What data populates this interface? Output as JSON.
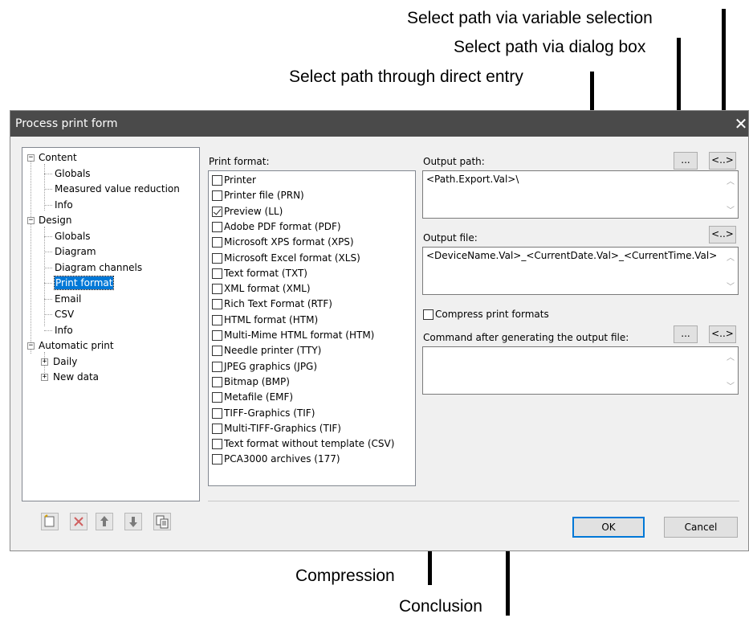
{
  "annotations": {
    "variable_selection": "Select path via variable selection",
    "dialog_box": "Select path via dialog box",
    "direct_entry": "Select path through direct entry",
    "compression": "Compression",
    "conclusion": "Conclusion"
  },
  "dialog": {
    "title": "Process print form",
    "close_glyph": "✕"
  },
  "tree": {
    "items": [
      {
        "label": "Content",
        "expander": "−"
      },
      {
        "label": "Globals"
      },
      {
        "label": "Measured value reduction"
      },
      {
        "label": "Info"
      },
      {
        "label": "Design",
        "expander": "−"
      },
      {
        "label": "Globals"
      },
      {
        "label": "Diagram"
      },
      {
        "label": "Diagram channels"
      },
      {
        "label": "Print format",
        "selected": true
      },
      {
        "label": "Email"
      },
      {
        "label": "CSV"
      },
      {
        "label": "Info"
      },
      {
        "label": "Automatic print",
        "expander": "−"
      },
      {
        "label": "Daily",
        "expander": "+"
      },
      {
        "label": "New data",
        "expander": "+"
      }
    ]
  },
  "toolbar": {
    "icons": [
      "new-entry-icon",
      "delete-icon",
      "move-up-icon",
      "move-down-icon",
      "copy-icon"
    ]
  },
  "print_format": {
    "label": "Print format:",
    "options": [
      {
        "label": "Printer",
        "checked": false
      },
      {
        "label": "Printer file (PRN)",
        "checked": false
      },
      {
        "label": "Preview (LL)",
        "checked": true
      },
      {
        "label": "Adobe PDF format (PDF)",
        "checked": false
      },
      {
        "label": "Microsoft XPS format (XPS)",
        "checked": false
      },
      {
        "label": "Microsoft Excel format (XLS)",
        "checked": false
      },
      {
        "label": "Text format (TXT)",
        "checked": false
      },
      {
        "label": "XML format (XML)",
        "checked": false
      },
      {
        "label": "Rich Text Format (RTF)",
        "checked": false
      },
      {
        "label": "HTML format (HTM)",
        "checked": false
      },
      {
        "label": "Multi-Mime HTML format (HTM)",
        "checked": false
      },
      {
        "label": "Needle printer (TTY)",
        "checked": false
      },
      {
        "label": "JPEG graphics (JPG)",
        "checked": false
      },
      {
        "label": "Bitmap (BMP)",
        "checked": false
      },
      {
        "label": "Metafile (EMF)",
        "checked": false
      },
      {
        "label": "TIFF-Graphics (TIF)",
        "checked": false
      },
      {
        "label": "Multi-TIFF-Graphics (TIF)",
        "checked": false
      },
      {
        "label": "Text format without template (CSV)",
        "checked": false
      },
      {
        "label": "PCA3000 archives (177)",
        "checked": false
      }
    ]
  },
  "output_path": {
    "label": "Output path:",
    "value": "<Path.Export.Val>\\",
    "dialog_btn": "...",
    "variable_btn": "<..>"
  },
  "output_file": {
    "label": "Output file:",
    "value": "<DeviceName.Val>_<CurrentDate.Val>_<CurrentTime.Val>",
    "variable_btn": "<..>"
  },
  "compress": {
    "label": "Compress print formats",
    "checked": false
  },
  "command": {
    "label": "Command after generating the output file:",
    "value": "",
    "dialog_btn": "...",
    "variable_btn": "<..>"
  },
  "buttons": {
    "ok": "OK",
    "cancel": "Cancel"
  }
}
